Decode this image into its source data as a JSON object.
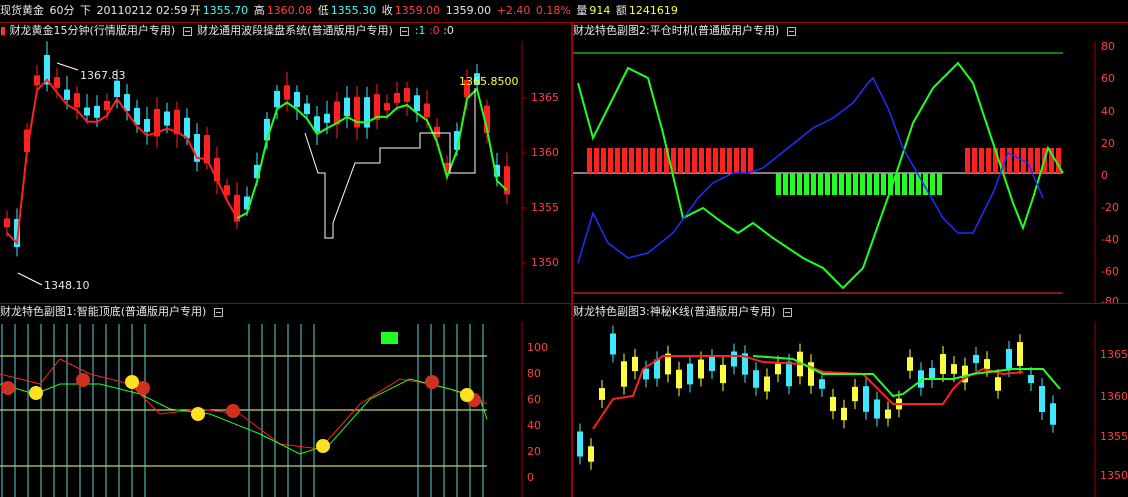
{
  "topbar": {
    "symbol": "现货黄金",
    "period": "60分",
    "dir": "下",
    "datetime": "20110212 02:59",
    "open_label": "开",
    "open": "1355.70",
    "high_label": "高",
    "high": "1360.08",
    "low_label": "低",
    "low": "1355.30",
    "close_label": "收",
    "close": "1359.00",
    "last": "1359.00",
    "change": "+2.40",
    "pct": "0.18%",
    "vol_label": "量",
    "vol": "914",
    "amt_label": "额",
    "amt": "1241619"
  },
  "panels": {
    "main": {
      "title": "财龙黄金15分钟(行情版用户专用)",
      "title2": "财龙通用波段操盘系统(普通版用户专用)",
      "title3_a": ":1",
      "title3_b": ":0",
      "title3_c": ":0",
      "high_label": "1367.83",
      "low_label": "1348.10",
      "price_tag": "1365.8500",
      "ticks": [
        "1365",
        "1360",
        "1355",
        "1350"
      ]
    },
    "sub2": {
      "title": "财龙特色副图2:平仓时机(普通版用户专用)",
      "ticks": [
        "80",
        "60",
        "40",
        "20",
        "0",
        "-20",
        "-40",
        "-60",
        "-80"
      ]
    },
    "sub1": {
      "title": "财龙特色副图1:智能顶底(普通版用户专用)",
      "ticks": [
        "100",
        "80",
        "60",
        "40",
        "20",
        "0"
      ]
    },
    "sub3": {
      "title": "财龙特色副图3:神秘K线(普通版用户专用)",
      "ticks": [
        "1365",
        "1360",
        "1355",
        "1350"
      ]
    }
  },
  "colors": {
    "up": "#ff2020",
    "down": "#40e8ff",
    "ma_red": "#ff2020",
    "ma_green": "#20ff20",
    "grid_red": "#a00000",
    "blue": "#2030ff",
    "yellow": "#ffff40"
  }
}
